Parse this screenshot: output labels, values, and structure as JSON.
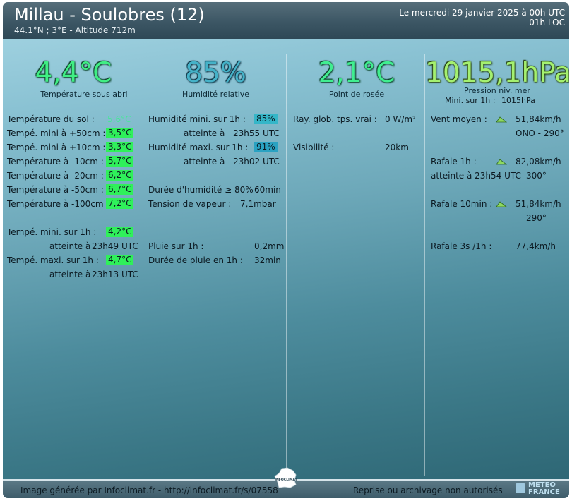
{
  "header": {
    "title": "Millau - Soulobres (12)",
    "coords": "44.1°N ; 3°E - Altitude 712m",
    "date_line1": "Le mercredi 29 janvier 2025 à 00h UTC",
    "date_line2": "01h LOC"
  },
  "big": {
    "temperature": "4,4°C",
    "temperature_label": "Température sous abri",
    "humidity": "85%",
    "humidity_label": "Humidité relative",
    "dewpoint": "2,1°C",
    "dewpoint_label": "Point de rosée",
    "pressure": "1015,1hPa",
    "pressure_label": "Pression niv. mer",
    "pressure_min_label": "Mini. sur 1h :",
    "pressure_min_value": "1015hPa"
  },
  "temps": {
    "rows": [
      {
        "label": "Température du sol :",
        "value": "5,6°C"
      },
      {
        "label": "Tempé. mini à +50cm :",
        "value": "3,5°C"
      },
      {
        "label": "Tempé. mini à +10cm :",
        "value": "3,3°C"
      },
      {
        "label": "Température à -10cm :",
        "value": "5,7°C"
      },
      {
        "label": "Température à -20cm :",
        "value": "6,2°C"
      },
      {
        "label": "Température à -50cm :",
        "value": "6,7°C"
      },
      {
        "label": "Température à -100cm :",
        "value": "7,2°C"
      }
    ],
    "min_label": "Tempé. mini. sur 1h :",
    "min_value": "4,2°C",
    "min_at_label": "atteinte à",
    "min_at_time": "23h49 UTC",
    "max_label": "Tempé. maxi. sur 1h :",
    "max_value": "4,7°C",
    "max_at_label": "atteinte à",
    "max_at_time": "23h13 UTC"
  },
  "humid": {
    "min_label": "Humidité mini. sur 1h :",
    "min_value": "85%",
    "min_at_label": "atteinte à",
    "min_at_time": "23h55 UTC",
    "max_label": "Humidité maxi. sur 1h :",
    "max_value": "91%",
    "max_at_label": "atteinte à",
    "max_at_time": "23h02 UTC",
    "duration_label": "Durée d'humidité ≥ 80% :",
    "duration_value": "60min",
    "vapor_label": "Tension de vapeur :",
    "vapor_value": "7,1mbar",
    "rain_label": "Pluie sur 1h :",
    "rain_value": "0,2mm",
    "rain_dur_label": "Durée de pluie en 1h :",
    "rain_dur_value": "32min"
  },
  "radiation": {
    "ray_label": "Ray. glob. tps. vrai :",
    "ray_value": "0 W/m²",
    "vis_label": "Visibilité :",
    "vis_value": "20km"
  },
  "wind": {
    "mean_label": "Vent moyen :",
    "mean_value": "51,84km/h",
    "mean_dir": "ONO - 290°",
    "gust1h_label": "Rafale 1h :",
    "gust1h_value": "82,08km/h",
    "gust1h_at": "atteinte à 23h54 UTC",
    "gust1h_dir": "300°",
    "gust10_label": "Rafale 10min :",
    "gust10_value": "51,84km/h",
    "gust10_dir": "290°",
    "gust3s_label": "Rafale 3s /1h :",
    "gust3s_value": "77,4km/h"
  },
  "footer": {
    "left": "Image générée par Infoclimat.fr - http://infoclimat.fr/s/07558",
    "right": "Reprise ou archivage non autorisés",
    "mf_text1": "METEO",
    "mf_text2": "FRANCE",
    "ic_text": "INFOCLIMAT"
  },
  "colors": {
    "temp_big": "#40ee84",
    "humidity_big": "#45b2c8",
    "pressure_big": "#a4f070",
    "badge_green": "#2ff05a",
    "badge_cyan": "#35b6c8"
  }
}
